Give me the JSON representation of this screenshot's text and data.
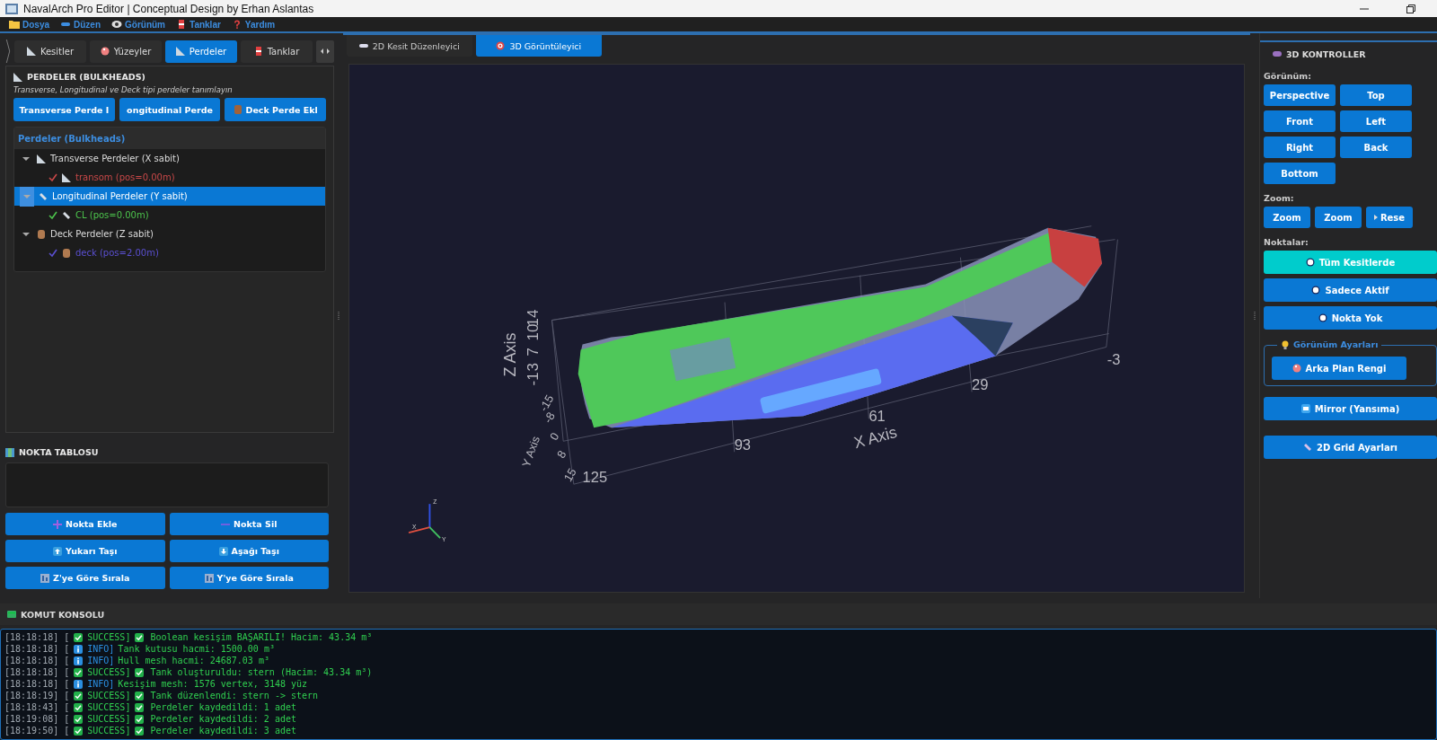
{
  "window": {
    "title": "NavalArch Pro Editor | Conceptual Design by Erhan Aslantas"
  },
  "menu": [
    {
      "label": "Dosya"
    },
    {
      "label": "Düzen"
    },
    {
      "label": "Görünüm"
    },
    {
      "label": "Tanklar"
    },
    {
      "label": "Yardım"
    }
  ],
  "left_tabs": [
    {
      "label": "Kesitler",
      "selected": false
    },
    {
      "label": "Yüzeyler",
      "selected": false
    },
    {
      "label": "Perdeler",
      "selected": true
    },
    {
      "label": "Tanklar",
      "selected": false
    }
  ],
  "bulkheads": {
    "title": "PERDELER (BULKHEADS)",
    "hint": "Transverse, Longitudinal ve Deck tipi perdeler tanımlayın",
    "buttons": [
      "Transverse Perde I",
      "ongitudinal Perde",
      "Deck Perde Ekl"
    ],
    "tree_header": "Perdeler (Bulkheads)",
    "groups": [
      {
        "label": "Transverse Perdeler (X sabit)",
        "expanded": true,
        "selected": false,
        "children": [
          {
            "label": "transom (pos=0.00m)",
            "checked": true,
            "color": "#c84848"
          }
        ]
      },
      {
        "label": "Longitudinal Perdeler (Y sabit)",
        "expanded": true,
        "selected": true,
        "children": [
          {
            "label": "CL (pos=0.00m)",
            "checked": true,
            "color": "#4cc44c"
          }
        ]
      },
      {
        "label": "Deck Perdeler (Z sabit)",
        "expanded": true,
        "selected": false,
        "children": [
          {
            "label": "deck (pos=2.00m)",
            "checked": true,
            "color": "#5a4fd0"
          }
        ]
      }
    ]
  },
  "points": {
    "title": "NOKTA TABLOSU",
    "buttons": [
      "Nokta Ekle",
      "Nokta Sil",
      "Yukarı Taşı",
      "Aşağı Taşı",
      "Z'ye Göre Sırala",
      "Y'ye Göre Sırala"
    ]
  },
  "view_tabs": [
    {
      "label": "2D Kesit Düzenleyici",
      "selected": false
    },
    {
      "label": "3D Görüntüleyici",
      "selected": true
    }
  ],
  "viewport": {
    "x_axis": {
      "title": "X Axis",
      "ticks": [
        "125",
        "93",
        "61",
        "29",
        "-3"
      ]
    },
    "y_axis": {
      "title": "Y Axis",
      "ticks": [
        "-15",
        "-8",
        "0",
        "8",
        "15"
      ]
    },
    "z_axis": {
      "title": "Z Axis",
      "ticks": [
        "-1",
        "3",
        "7",
        "10",
        "14"
      ]
    },
    "gizmo_labels": [
      "Z",
      "X",
      "Y"
    ]
  },
  "controls": {
    "title": "3D KONTROLLER",
    "view_label": "Görünüm:",
    "view_buttons": [
      "Perspective",
      "Top",
      "Front",
      "Left",
      "Right",
      "Back",
      "Bottom"
    ],
    "zoom_label": "Zoom:",
    "zoom_buttons": [
      "Zoom",
      "Zoom",
      "Rese"
    ],
    "points_label": "Noktalar:",
    "point_modes": [
      {
        "label": "Tüm Kesitlerde",
        "selected": true
      },
      {
        "label": "Sadece Aktif",
        "selected": false
      },
      {
        "label": "Nokta Yok",
        "selected": false
      }
    ],
    "settings_group": "Görünüm Ayarları",
    "background_button": "Arka Plan Rengi",
    "mirror_button": "Mirror (Yansıma)",
    "grid_button": "2D Grid Ayarları"
  },
  "console": {
    "title": "KOMUT KONSOLU",
    "lines": [
      {
        "time": "[18:18:18] [",
        "kind": "success",
        "tag": "SUCCESS]",
        "message": "Boolean kesişim BAŞARILI! Hacim: 43.34 m³"
      },
      {
        "time": "[18:18:18] [",
        "kind": "info",
        "tag": "INFO]",
        "message": "Tank kutusu hacmi: 1500.00 m³"
      },
      {
        "time": "[18:18:18] [",
        "kind": "info",
        "tag": "INFO]",
        "message": "Hull mesh hacmi: 24687.03 m³"
      },
      {
        "time": "[18:18:18] [",
        "kind": "success",
        "tag": "SUCCESS]",
        "message": "Tank oluşturuldu: stern (Hacim: 43.34 m³)"
      },
      {
        "time": "[18:18:18] [",
        "kind": "info",
        "tag": "INFO]",
        "message": "Kesişim mesh: 1576 vertex, 3148 yüz"
      },
      {
        "time": "[18:18:19] [",
        "kind": "success",
        "tag": "SUCCESS]",
        "message": "Tank düzenlendi: stern -> stern"
      },
      {
        "time": "[18:18:43] [",
        "kind": "success",
        "tag": "SUCCESS]",
        "message": "Perdeler kaydedildi: 1 adet"
      },
      {
        "time": "[18:19:08] [",
        "kind": "success",
        "tag": "SUCCESS]",
        "message": "Perdeler kaydedildi: 2 adet"
      },
      {
        "time": "[18:19:50] [",
        "kind": "success",
        "tag": "SUCCESS]",
        "message": "Perdeler kaydedildi: 3 adet"
      }
    ]
  }
}
